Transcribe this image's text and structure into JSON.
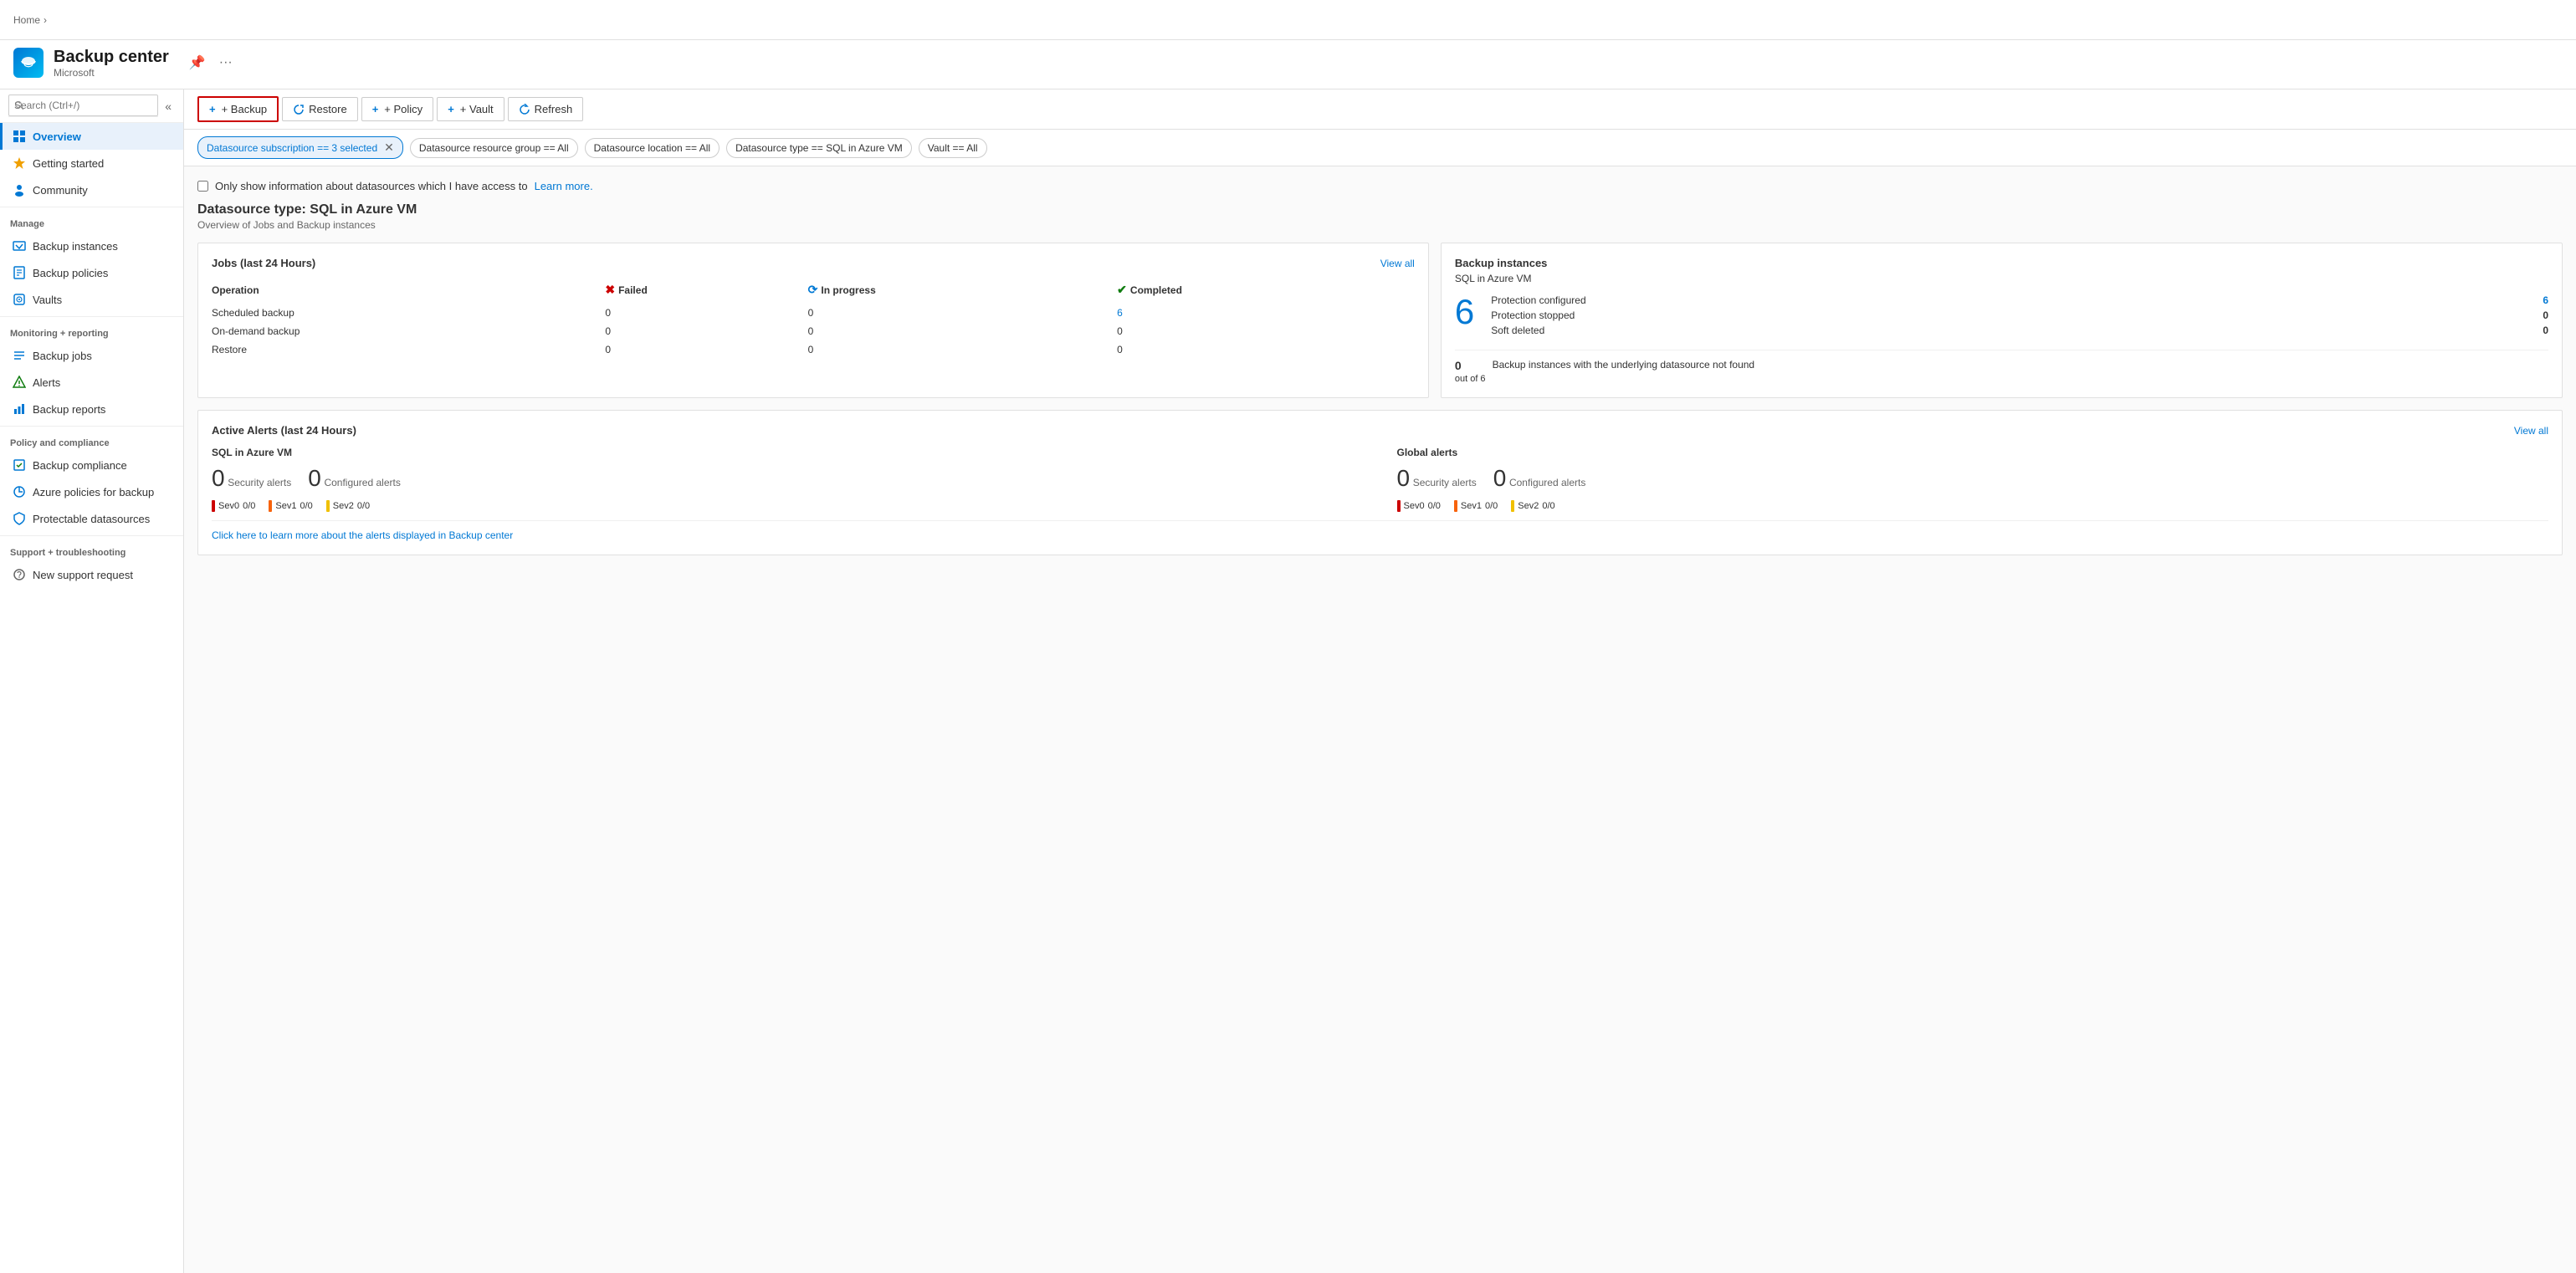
{
  "breadcrumb": {
    "home": "Home"
  },
  "header": {
    "title": "Backup center",
    "subtitle": "Microsoft"
  },
  "toolbar": {
    "backup_label": "+ Backup",
    "restore_label": "Restore",
    "policy_label": "+ Policy",
    "vault_label": "+ Vault",
    "refresh_label": "Refresh"
  },
  "filters": [
    {
      "label": "Datasource subscription == 3 selected",
      "active": true
    },
    {
      "label": "Datasource resource group == All",
      "active": false
    },
    {
      "label": "Datasource location == All",
      "active": false
    },
    {
      "label": "Datasource type == SQL in Azure VM",
      "active": false
    },
    {
      "label": "Vault == All",
      "active": false
    }
  ],
  "checkbox": {
    "label": "Only show information about datasources which I have access to",
    "link_text": "Learn more."
  },
  "section": {
    "title": "Datasource type: SQL in Azure VM",
    "subtitle": "Overview of Jobs and Backup instances"
  },
  "jobs_card": {
    "title": "Jobs (last 24 Hours)",
    "view_all": "View all",
    "headers": [
      "Operation",
      "Failed",
      "In progress",
      "Completed"
    ],
    "rows": [
      {
        "operation": "Scheduled backup",
        "failed": "0",
        "in_progress": "0",
        "completed": "6"
      },
      {
        "operation": "On-demand backup",
        "failed": "0",
        "in_progress": "0",
        "completed": "0"
      },
      {
        "operation": "Restore",
        "failed": "0",
        "in_progress": "0",
        "completed": "0"
      }
    ]
  },
  "backup_instances_card": {
    "title": "Backup instances",
    "type": "SQL in Azure VM",
    "big_number": "6",
    "stats": [
      {
        "label": "Protection configured",
        "value": "6",
        "is_link": true
      },
      {
        "label": "Protection stopped",
        "value": "0",
        "is_link": false
      },
      {
        "label": "Soft deleted",
        "value": "0",
        "is_link": false
      }
    ],
    "bottom_number": "0",
    "bottom_outof": "out of 6",
    "bottom_text": "Backup instances with the underlying datasource not found"
  },
  "alerts_card": {
    "title": "Active Alerts (last 24 Hours)",
    "view_all": "View all",
    "sql_section": {
      "title": "SQL in Azure VM",
      "security_count": "0",
      "security_label": "Security alerts",
      "configured_count": "0",
      "configured_label": "Configured alerts",
      "sevs": [
        {
          "label": "Sev0",
          "value": "0/0"
        },
        {
          "label": "Sev1",
          "value": "0/0"
        },
        {
          "label": "Sev2",
          "value": "0/0"
        }
      ]
    },
    "global_section": {
      "title": "Global alerts",
      "security_count": "0",
      "security_label": "Security alerts",
      "configured_count": "0",
      "configured_label": "Configured alerts",
      "sevs": [
        {
          "label": "Sev0",
          "value": "0/0"
        },
        {
          "label": "Sev1",
          "value": "0/0"
        },
        {
          "label": "Sev2",
          "value": "0/0"
        }
      ]
    },
    "learn_more_link": "Click here to learn more about the alerts displayed in Backup center"
  },
  "sidebar": {
    "search_placeholder": "Search (Ctrl+/)",
    "items_top": [
      {
        "id": "overview",
        "label": "Overview",
        "active": true
      },
      {
        "id": "getting-started",
        "label": "Getting started",
        "active": false
      },
      {
        "id": "community",
        "label": "Community",
        "active": false
      }
    ],
    "manage_label": "Manage",
    "items_manage": [
      {
        "id": "backup-instances",
        "label": "Backup instances",
        "active": false
      },
      {
        "id": "backup-policies",
        "label": "Backup policies",
        "active": false
      },
      {
        "id": "vaults",
        "label": "Vaults",
        "active": false
      }
    ],
    "monitoring_label": "Monitoring + reporting",
    "items_monitoring": [
      {
        "id": "backup-jobs",
        "label": "Backup jobs",
        "active": false
      },
      {
        "id": "alerts",
        "label": "Alerts",
        "active": false
      },
      {
        "id": "backup-reports",
        "label": "Backup reports",
        "active": false
      }
    ],
    "policy_label": "Policy and compliance",
    "items_policy": [
      {
        "id": "backup-compliance",
        "label": "Backup compliance",
        "active": false
      },
      {
        "id": "azure-policies",
        "label": "Azure policies for backup",
        "active": false
      },
      {
        "id": "protectable-datasources",
        "label": "Protectable datasources",
        "active": false
      }
    ],
    "support_label": "Support + troubleshooting",
    "items_support": [
      {
        "id": "new-support-request",
        "label": "New support request",
        "active": false
      }
    ]
  }
}
